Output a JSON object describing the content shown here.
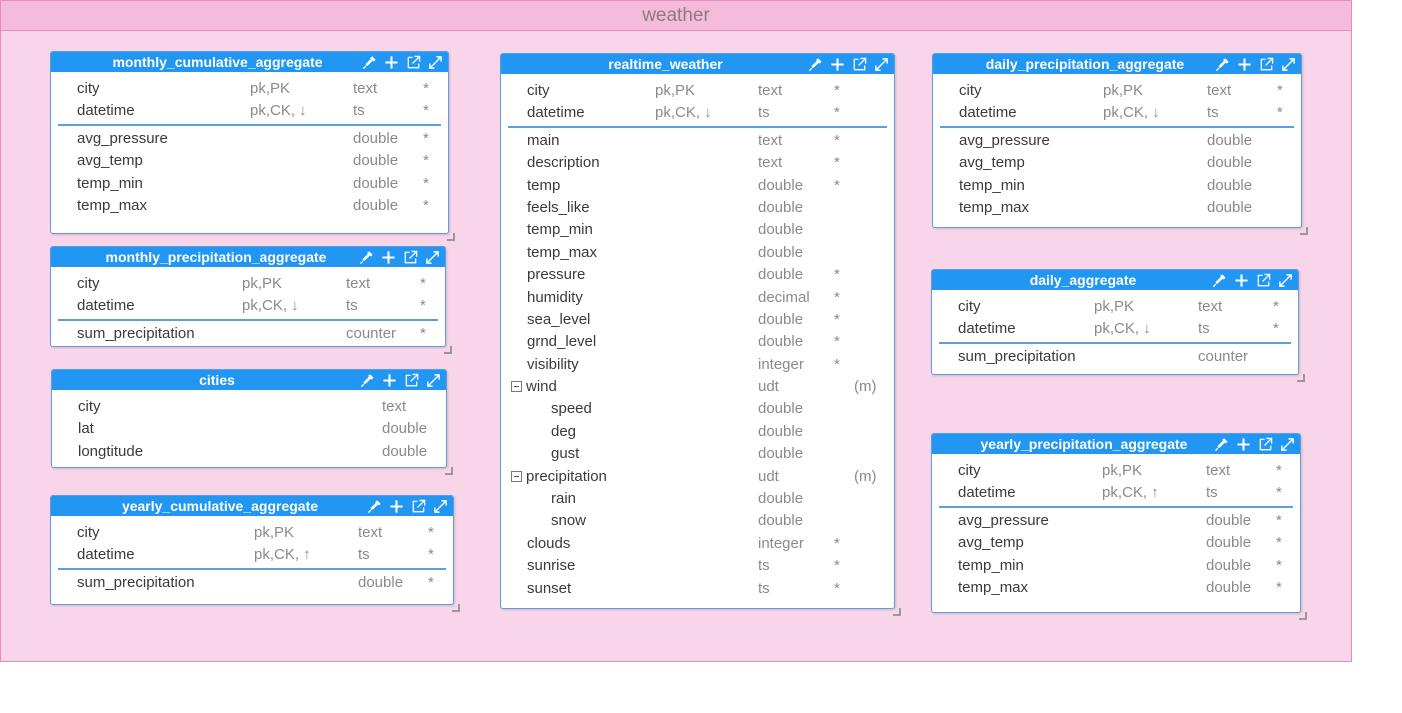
{
  "keyspace": {
    "title": "weather"
  },
  "tables": [
    {
      "id": "monthly_cumulative_aggregate",
      "name": "monthly_cumulative_aggregate",
      "columns": [
        {
          "name": "city",
          "key": "pk,PK",
          "type": "text",
          "req": "*"
        },
        {
          "name": "datetime",
          "key": "pk,CK, ↓",
          "type": "ts",
          "req": "*",
          "sep_after": true
        },
        {
          "name": "avg_pressure",
          "key": "",
          "type": "double",
          "req": "*"
        },
        {
          "name": "avg_temp",
          "key": "",
          "type": "double",
          "req": "*"
        },
        {
          "name": "temp_min",
          "key": "",
          "type": "double",
          "req": "*"
        },
        {
          "name": "temp_max",
          "key": "",
          "type": "double",
          "req": "*"
        }
      ]
    },
    {
      "id": "monthly_precipitation_aggregate",
      "name": "monthly_precipitation_aggregate",
      "columns": [
        {
          "name": "city",
          "key": "pk,PK",
          "type": "text",
          "req": "*"
        },
        {
          "name": "datetime",
          "key": "pk,CK, ↓",
          "type": "ts",
          "req": "*",
          "sep_after": true
        },
        {
          "name": "sum_precipitation",
          "key": "",
          "type": "counter",
          "req": "*"
        }
      ]
    },
    {
      "id": "cities",
      "name": "cities",
      "columns": [
        {
          "name": "city",
          "key": "",
          "type": "text",
          "req": ""
        },
        {
          "name": "lat",
          "key": "",
          "type": "double",
          "req": ""
        },
        {
          "name": "longtitude",
          "key": "",
          "type": "double",
          "req": ""
        }
      ]
    },
    {
      "id": "yearly_cumulative_aggregate",
      "name": "yearly_cumulative_aggregate",
      "columns": [
        {
          "name": "city",
          "key": "pk,PK",
          "type": "text",
          "req": "*"
        },
        {
          "name": "datetime",
          "key": "pk,CK, ↑",
          "type": "ts",
          "req": "*",
          "sep_after": true
        },
        {
          "name": "sum_precipitation",
          "key": "",
          "type": "double",
          "req": "*"
        }
      ]
    },
    {
      "id": "realtime_weather",
      "name": "realtime_weather",
      "columns": [
        {
          "name": "city",
          "key": "pk,PK",
          "type": "text",
          "req": "*"
        },
        {
          "name": "datetime",
          "key": "pk,CK, ↓",
          "type": "ts",
          "req": "*",
          "sep_after": true
        },
        {
          "name": "main",
          "key": "",
          "type": "text",
          "req": "*"
        },
        {
          "name": "description",
          "key": "",
          "type": "text",
          "req": "*"
        },
        {
          "name": "temp",
          "key": "",
          "type": "double",
          "req": "*"
        },
        {
          "name": "feels_like",
          "key": "",
          "type": "double",
          "req": ""
        },
        {
          "name": "temp_min",
          "key": "",
          "type": "double",
          "req": ""
        },
        {
          "name": "temp_max",
          "key": "",
          "type": "double",
          "req": ""
        },
        {
          "name": "pressure",
          "key": "",
          "type": "double",
          "req": "*"
        },
        {
          "name": "humidity",
          "key": "",
          "type": "decimal",
          "req": "*"
        },
        {
          "name": "sea_level",
          "key": "",
          "type": "double",
          "req": "*"
        },
        {
          "name": "grnd_level",
          "key": "",
          "type": "double",
          "req": "*"
        },
        {
          "name": "visibility",
          "key": "",
          "type": "integer",
          "req": "*"
        },
        {
          "name": "wind",
          "key": "",
          "type": "udt",
          "req": "",
          "extra": "(m)",
          "expander": true
        },
        {
          "name": "speed",
          "key": "",
          "type": "double",
          "req": "",
          "sub": true
        },
        {
          "name": "deg",
          "key": "",
          "type": "double",
          "req": "",
          "sub": true
        },
        {
          "name": "gust",
          "key": "",
          "type": "double",
          "req": "",
          "sub": true
        },
        {
          "name": "precipitation",
          "key": "",
          "type": "udt",
          "req": "",
          "extra": "(m)",
          "expander": true
        },
        {
          "name": "rain",
          "key": "",
          "type": "double",
          "req": "",
          "sub": true
        },
        {
          "name": "snow",
          "key": "",
          "type": "double",
          "req": "",
          "sub": true
        },
        {
          "name": "clouds",
          "key": "",
          "type": "integer",
          "req": "*"
        },
        {
          "name": "sunrise",
          "key": "",
          "type": "ts",
          "req": "*"
        },
        {
          "name": "sunset",
          "key": "",
          "type": "ts",
          "req": "*"
        }
      ]
    },
    {
      "id": "daily_precipitation_aggregate",
      "name": "daily_precipitation_aggregate",
      "columns": [
        {
          "name": "city",
          "key": "pk,PK",
          "type": "text",
          "req": "*"
        },
        {
          "name": "datetime",
          "key": "pk,CK, ↓",
          "type": "ts",
          "req": "*",
          "sep_after": true
        },
        {
          "name": "avg_pressure",
          "key": "",
          "type": "double",
          "req": ""
        },
        {
          "name": "avg_temp",
          "key": "",
          "type": "double",
          "req": ""
        },
        {
          "name": "temp_min",
          "key": "",
          "type": "double",
          "req": ""
        },
        {
          "name": "temp_max",
          "key": "",
          "type": "double",
          "req": ""
        }
      ]
    },
    {
      "id": "daily_aggregate",
      "name": "daily_aggregate",
      "columns": [
        {
          "name": "city",
          "key": "pk,PK",
          "type": "text",
          "req": "*"
        },
        {
          "name": "datetime",
          "key": "pk,CK, ↓",
          "type": "ts",
          "req": "*",
          "sep_after": true
        },
        {
          "name": "sum_precipitation",
          "key": "",
          "type": "counter",
          "req": ""
        }
      ]
    },
    {
      "id": "yearly_precipitation_aggregate",
      "name": "yearly_precipitation_aggregate",
      "columns": [
        {
          "name": "city",
          "key": "pk,PK",
          "type": "text",
          "req": "*"
        },
        {
          "name": "datetime",
          "key": "pk,CK, ↑",
          "type": "ts",
          "req": "*",
          "sep_after": true
        },
        {
          "name": "avg_pressure",
          "key": "",
          "type": "double",
          "req": "*"
        },
        {
          "name": "avg_temp",
          "key": "",
          "type": "double",
          "req": "*"
        },
        {
          "name": "temp_min",
          "key": "",
          "type": "double",
          "req": "*"
        },
        {
          "name": "temp_max",
          "key": "",
          "type": "double",
          "req": "*"
        }
      ]
    }
  ],
  "toolbar_icons": [
    "eyedropper-icon",
    "plus-icon",
    "open-external-icon",
    "expand-icon"
  ]
}
